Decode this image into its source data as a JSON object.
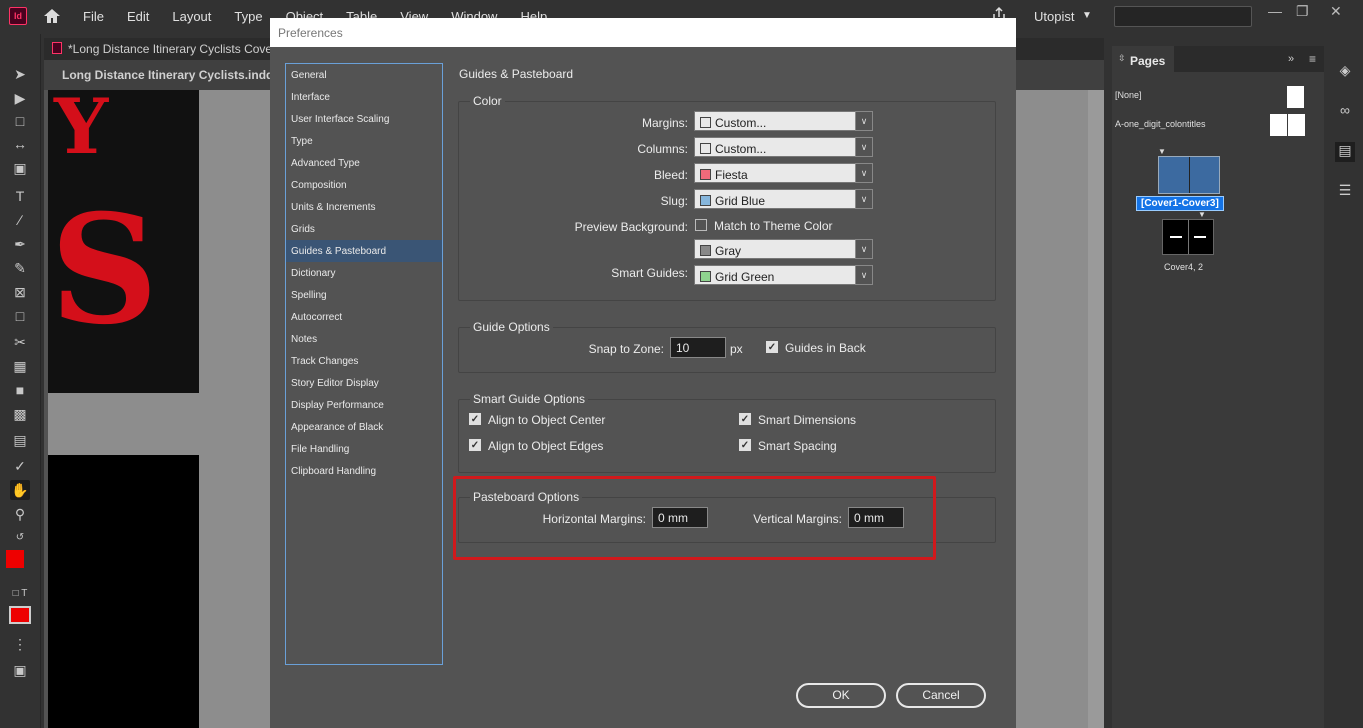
{
  "menubar": {
    "app_icon": "Id",
    "items": [
      "File",
      "Edit",
      "Layout",
      "Type",
      "Object",
      "Table",
      "View",
      "Window",
      "Help"
    ],
    "workspace": "Utopist"
  },
  "document": {
    "tab_title": "*Long Distance Itinerary Cyclists Cover",
    "window_title": "Long Distance Itinerary Cyclists.indd @",
    "letters": [
      "Y",
      "S"
    ]
  },
  "pages_panel": {
    "tab_label": "Pages",
    "masters": [
      "[None]",
      "A-one_digit_colontitles"
    ],
    "spreads": [
      {
        "label": "[Cover1-Cover3]"
      },
      {
        "label": "Cover4, 2"
      }
    ]
  },
  "dialog": {
    "title": "Preferences",
    "categories": [
      "General",
      "Interface",
      "User Interface Scaling",
      "Type",
      "Advanced Type",
      "Composition",
      "Units & Increments",
      "Grids",
      "Guides & Pasteboard",
      "Dictionary",
      "Spelling",
      "Autocorrect",
      "Notes",
      "Track Changes",
      "Story Editor Display",
      "Display Performance",
      "Appearance of Black",
      "File Handling",
      "Clipboard Handling"
    ],
    "selected_category": "Guides & Pasteboard",
    "section_heading": "Guides & Pasteboard",
    "color": {
      "title": "Color",
      "margins_label": "Margins:",
      "margins_value": "Custom...",
      "columns_label": "Columns:",
      "columns_value": "Custom...",
      "bleed_label": "Bleed:",
      "bleed_value": "Fiesta",
      "slug_label": "Slug:",
      "slug_value": "Grid Blue",
      "preview_bg_label": "Preview Background:",
      "match_theme_label": "Match to Theme Color",
      "preview_bg_value": "Gray",
      "smart_guides_label": "Smart Guides:",
      "smart_guides_value": "Grid Green",
      "swatches": {
        "margins": "#e8e8e8",
        "columns": "#e8e8e8",
        "bleed": "#f06a7a",
        "slug": "#86b6dc",
        "gray": "#888888",
        "smart": "#8fd48f"
      }
    },
    "guide_options": {
      "title": "Guide Options",
      "snap_label": "Snap to Zone:",
      "snap_value": "10",
      "snap_unit": "px",
      "guides_in_back_label": "Guides in Back",
      "guides_in_back": true
    },
    "smart_guide_options": {
      "title": "Smart Guide Options",
      "align_center_label": "Align to Object Center",
      "align_edges_label": "Align to Object Edges",
      "smart_dimensions_label": "Smart Dimensions",
      "smart_spacing_label": "Smart Spacing"
    },
    "pasteboard_options": {
      "title": "Pasteboard Options",
      "horizontal_label": "Horizontal Margins:",
      "horizontal_value": "0 mm",
      "vertical_label": "Vertical Margins:",
      "vertical_value": "0 mm"
    },
    "ok_label": "OK",
    "cancel_label": "Cancel"
  },
  "colors": {
    "highlight": "#d1191c",
    "selection": "#3a5575",
    "accent_blue": "#1473e6"
  }
}
